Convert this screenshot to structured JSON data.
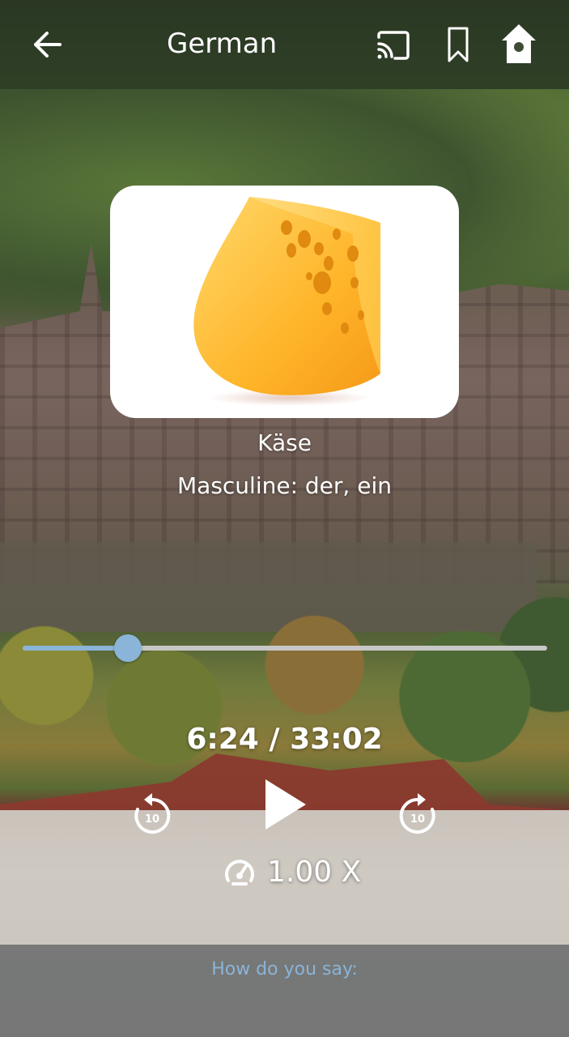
{
  "header": {
    "title": "German",
    "icons": [
      "back-arrow-icon",
      "cast-icon",
      "bookmark-icon",
      "birdhouse-home-icon"
    ]
  },
  "card": {
    "image": "cheese-wedge",
    "word": "Käse",
    "gender": "Masculine: der, ein"
  },
  "player": {
    "time_display": "6:24 / 33:02",
    "progress_fraction": 0.2,
    "speed_label": "1.00 X",
    "rewind_seconds": "10",
    "forward_seconds": "10",
    "accent_color": "#8ab4d8"
  },
  "footer": {
    "prompt": "How do you say:"
  }
}
